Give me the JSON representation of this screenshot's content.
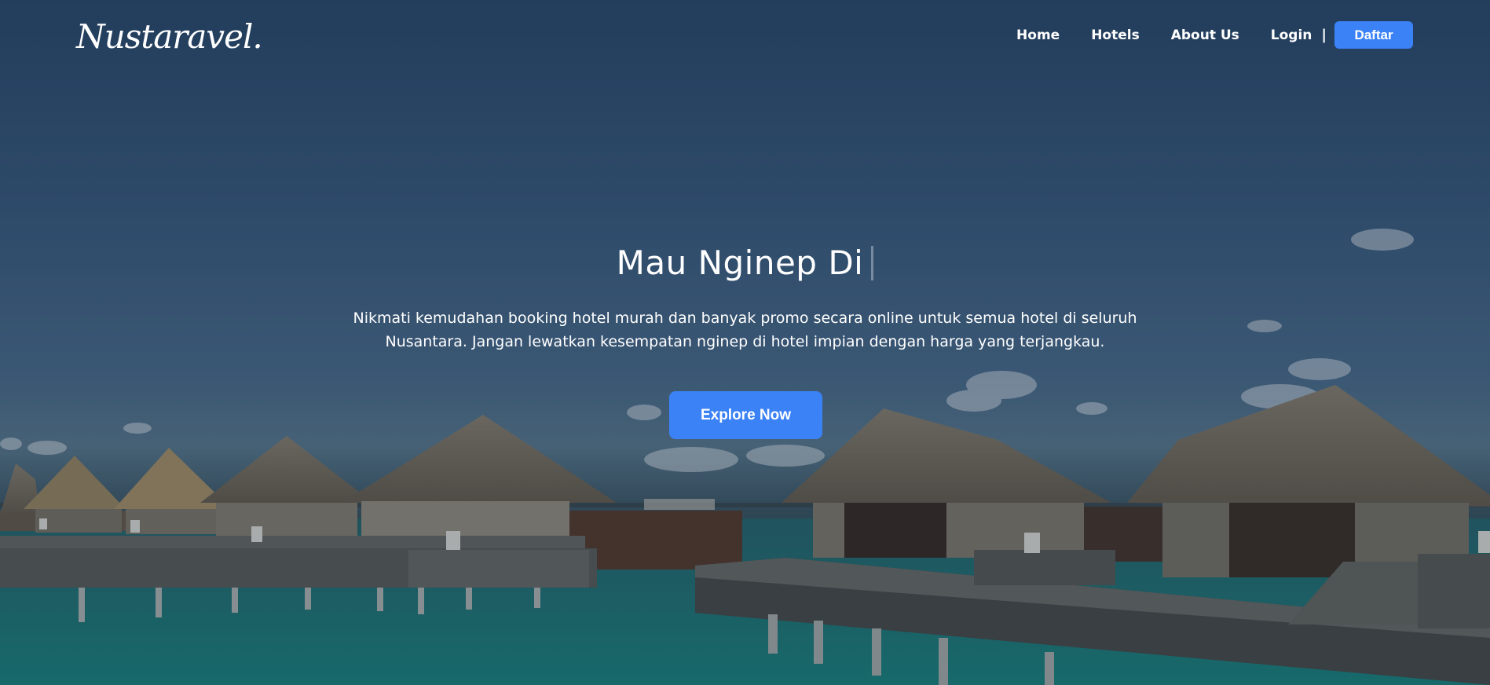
{
  "brand": {
    "logo_text": "Nustaravel."
  },
  "nav": {
    "links": [
      "Home",
      "Hotels",
      "About Us",
      "Login"
    ],
    "separator": "|",
    "register_button": "Daftar"
  },
  "hero": {
    "title": "Mau Nginep Di",
    "description_line1": "Nikmati kemudahan booking hotel murah dan banyak promo secara online untuk semua hotel di seluruh",
    "description_line2": "Nusantara. Jangan lewatkan kesempatan nginep di hotel impian dengan harga yang terjangkau.",
    "cta_button": "Explore Now"
  },
  "colors": {
    "accent": "#3b82f6",
    "text": "#ffffff"
  }
}
